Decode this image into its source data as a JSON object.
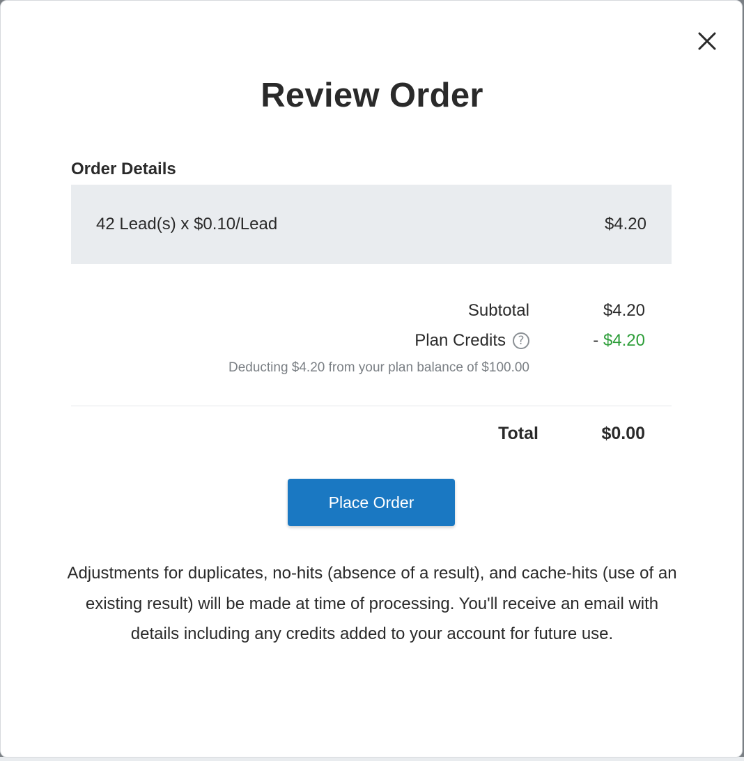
{
  "modal": {
    "title": "Review Order",
    "close_icon": "close-icon"
  },
  "order_details": {
    "label": "Order Details",
    "line_item": {
      "description": "42 Lead(s) x $0.10/Lead",
      "amount": "$4.20"
    }
  },
  "summary": {
    "subtotal_label": "Subtotal",
    "subtotal_value": "$4.20",
    "credits_label": "Plan Credits",
    "credits_help_icon": "question-circle-icon",
    "credits_prefix": "- ",
    "credits_value": "$4.20",
    "deduction_note": "Deducting $4.20 from your plan balance of $100.00",
    "total_label": "Total",
    "total_value": "$0.00"
  },
  "actions": {
    "place_order_label": "Place Order"
  },
  "footnote": "Adjustments for duplicates, no-hits (absence of a result), and cache-hits (use of an existing result) will be made at time of processing. You'll receive an email with details including any credits added to your account for future use.",
  "colors": {
    "accent": "#1a78c2",
    "credit_green": "#2e9e3a",
    "line_item_bg": "#e9ecef"
  }
}
